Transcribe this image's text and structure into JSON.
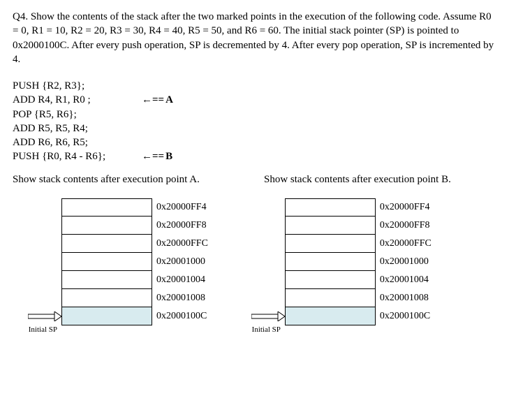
{
  "question": {
    "text": "Q4. Show the contents of the stack after the two marked points in the execution of the following code. Assume R0 = 0, R1 = 10, R2 = 20, R3 = 30, R4 = 40, R5 = 50, and R6 = 60. The initial stack pointer (SP) is pointed to 0x2000100C. After every push operation, SP is decremented by 4. After every pop operation, SP is incremented by 4."
  },
  "code": {
    "lines": [
      {
        "instr": "PUSH {R2, R3};",
        "marker": ""
      },
      {
        "instr": "ADD R4, R1, R0 ;",
        "marker": "A"
      },
      {
        "instr": "POP {R5, R6};",
        "marker": ""
      },
      {
        "instr": "ADD R5, R5, R4;",
        "marker": ""
      },
      {
        "instr": "ADD R6, R6, R5;",
        "marker": ""
      },
      {
        "instr": "PUSH {R0, R4 - R6};",
        "marker": "B"
      }
    ],
    "marker_prefix": "←=="
  },
  "prompts": {
    "a": "Show stack contents after execution point A.",
    "b": "Show stack contents after execution point B."
  },
  "stack": {
    "addresses": [
      "0x20000FF4",
      "0x20000FF8",
      "0x20000FFC",
      "0x20001000",
      "0x20001004",
      "0x20001008",
      "0x2000100C"
    ],
    "sp_label": "Initial SP"
  }
}
